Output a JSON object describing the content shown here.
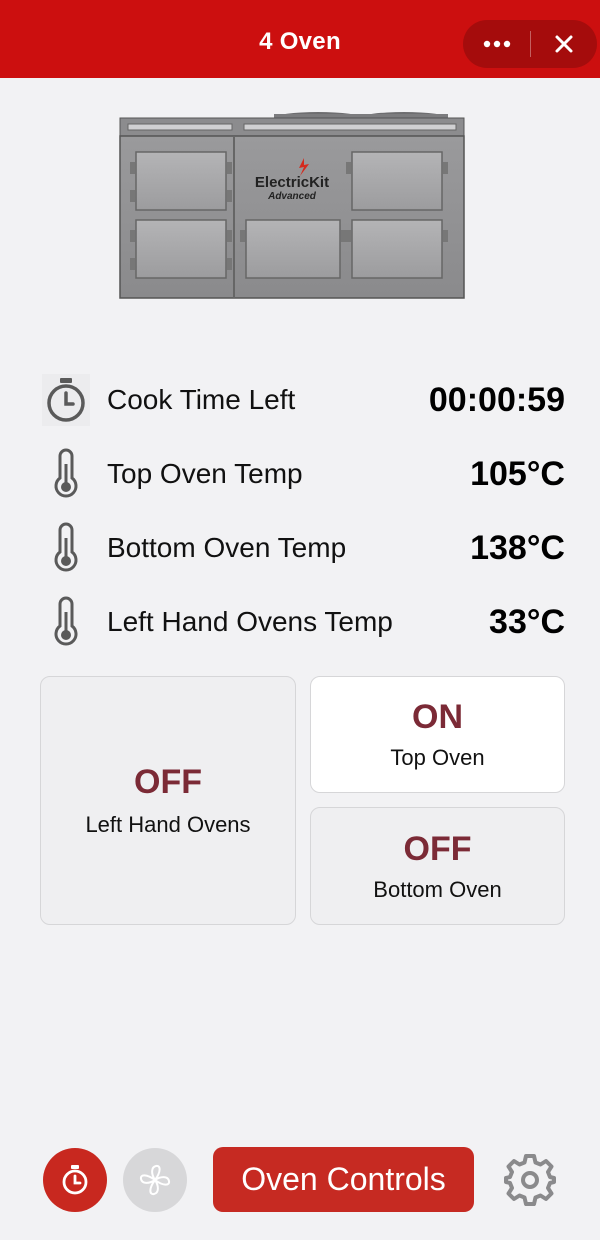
{
  "header": {
    "title": "4 Oven",
    "capsule": {
      "more_icon": "more-dots-icon",
      "close_icon": "close-icon"
    },
    "color": "#cc0f0f"
  },
  "oven_image": {
    "brand": "ElectricKit",
    "model": "Advanced"
  },
  "stats": [
    {
      "icon": "stopwatch-icon",
      "label": "Cook Time Left",
      "value": "00:00:59"
    },
    {
      "icon": "thermometer-icon",
      "label": "Top Oven Temp",
      "value": "105°C"
    },
    {
      "icon": "thermometer-icon",
      "label": "Bottom Oven Temp",
      "value": "138°C"
    },
    {
      "icon": "thermometer-icon",
      "label": "Left Hand Ovens Temp",
      "value": "33°C"
    }
  ],
  "ovens": {
    "left_hand": {
      "state": "OFF",
      "name": "Left Hand Ovens"
    },
    "top": {
      "state": "ON",
      "name": "Top Oven"
    },
    "bottom": {
      "state": "OFF",
      "name": "Bottom Oven"
    }
  },
  "bottom_bar": {
    "timer_icon": "stopwatch-icon",
    "fan_icon": "fan-icon",
    "oven_controls_label": "Oven Controls",
    "settings_icon": "gear-icon"
  },
  "colors": {
    "accent": "#c62a22",
    "state_text": "#7b2a36",
    "background": "#f2f2f4"
  }
}
